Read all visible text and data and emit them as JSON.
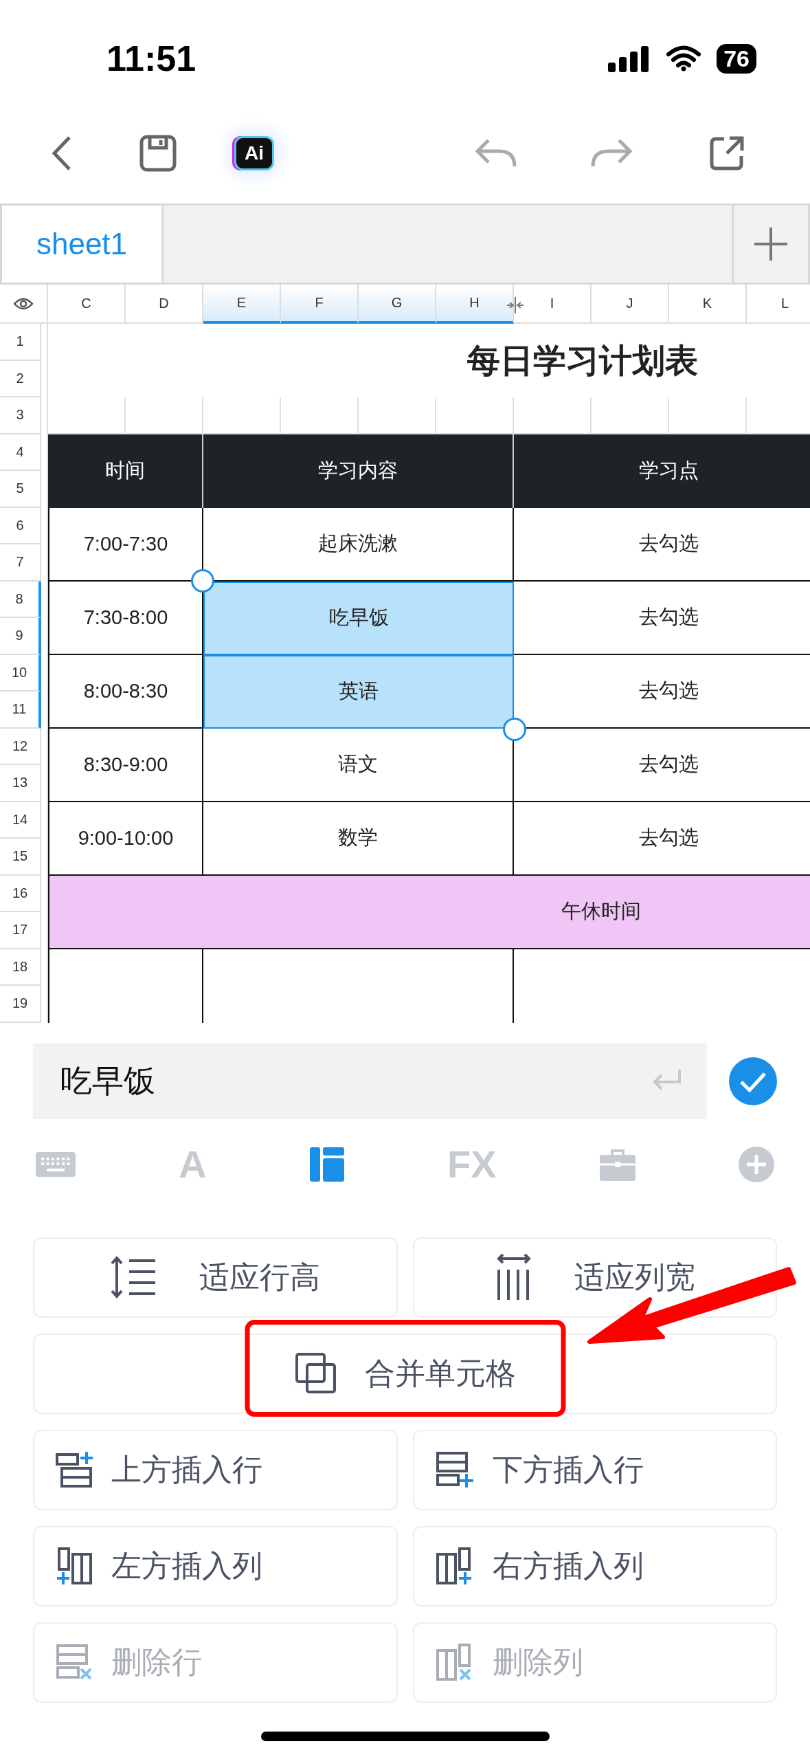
{
  "status_bar": {
    "time": "11:51",
    "battery": "76"
  },
  "toolbar": {
    "ai_label": "Ai"
  },
  "sheet_tabs": [
    {
      "label": "sheet1",
      "selected": true
    }
  ],
  "sheet": {
    "columns": [
      {
        "label": "C",
        "selected": false
      },
      {
        "label": "D",
        "selected": false
      },
      {
        "label": "E",
        "selected": true
      },
      {
        "label": "F",
        "selected": true
      },
      {
        "label": "G",
        "selected": true
      },
      {
        "label": "H",
        "selected": true
      },
      {
        "label": "I",
        "selected": false
      },
      {
        "label": "J",
        "selected": false
      },
      {
        "label": "K",
        "selected": false
      },
      {
        "label": "L",
        "selected": false
      }
    ],
    "rows": [
      {
        "label": "1",
        "selected": false
      },
      {
        "label": "2",
        "selected": false
      },
      {
        "label": "3",
        "selected": false
      },
      {
        "label": "4",
        "selected": false
      },
      {
        "label": "5",
        "selected": false
      },
      {
        "label": "6",
        "selected": false
      },
      {
        "label": "7",
        "selected": false
      },
      {
        "label": "8",
        "selected": true
      },
      {
        "label": "9",
        "selected": true
      },
      {
        "label": "10",
        "selected": true
      },
      {
        "label": "11",
        "selected": true
      },
      {
        "label": "12",
        "selected": false
      },
      {
        "label": "13",
        "selected": false
      },
      {
        "label": "14",
        "selected": false
      },
      {
        "label": "15",
        "selected": false
      },
      {
        "label": "16",
        "selected": false
      },
      {
        "label": "17",
        "selected": false
      },
      {
        "label": "18",
        "selected": false
      },
      {
        "label": "19",
        "selected": false
      }
    ],
    "title": "每日学习计划表",
    "headers": [
      "时间",
      "学习内容",
      "学习点"
    ],
    "entries": [
      {
        "time": "7:00-7:30",
        "content": "起床洗漱",
        "point": "去勾选",
        "selected": false
      },
      {
        "time": "7:30-8:00",
        "content": "吃早饭",
        "point": "去勾选",
        "selected": true
      },
      {
        "time": "8:00-8:30",
        "content": "英语",
        "point": "去勾选",
        "selected": true
      },
      {
        "time": "8:30-9:00",
        "content": "语文",
        "point": "去勾选",
        "selected": false
      },
      {
        "time": "9:00-10:00",
        "content": "数学",
        "point": "去勾选",
        "selected": false
      }
    ],
    "break": "午休时间"
  },
  "formula_bar": {
    "value": "吃早饭"
  },
  "panel_tabs": [
    {
      "kind": "keyboard",
      "selected": false
    },
    {
      "kind": "text",
      "label": "A",
      "selected": false
    },
    {
      "kind": "layout",
      "selected": true
    },
    {
      "kind": "text",
      "label": "FX",
      "selected": false
    },
    {
      "kind": "briefcase",
      "selected": false
    },
    {
      "kind": "plus",
      "selected": false
    }
  ],
  "actions": [
    {
      "kind": "fit_row_height",
      "label": "适应行高",
      "disabled": false,
      "wide": false,
      "highlighted": false
    },
    {
      "kind": "fit_col_width",
      "label": "适应列宽",
      "disabled": false,
      "wide": false,
      "highlighted": false
    },
    {
      "kind": "merge",
      "label": "合并单元格",
      "disabled": false,
      "wide": true,
      "highlighted": true
    },
    {
      "kind": "insert_above",
      "label": "上方插入行",
      "disabled": false,
      "wide": false,
      "highlighted": false
    },
    {
      "kind": "insert_below",
      "label": "下方插入行",
      "disabled": false,
      "wide": false,
      "highlighted": false
    },
    {
      "kind": "insert_left",
      "label": "左方插入列",
      "disabled": false,
      "wide": false,
      "highlighted": false
    },
    {
      "kind": "insert_right",
      "label": "右方插入列",
      "disabled": false,
      "wide": false,
      "highlighted": false
    },
    {
      "kind": "delete_row",
      "label": "删除行",
      "disabled": true,
      "wide": false,
      "highlighted": false
    },
    {
      "kind": "delete_col",
      "label": "删除列",
      "disabled": true,
      "wide": false,
      "highlighted": false
    }
  ]
}
